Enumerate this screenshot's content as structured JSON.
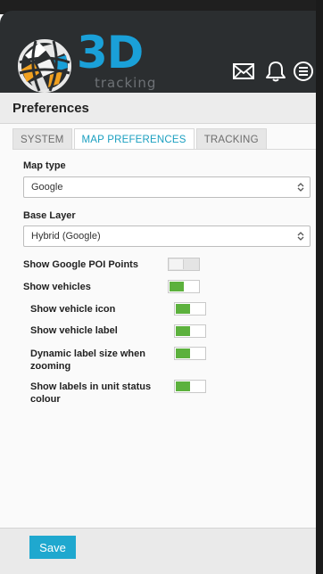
{
  "header": {
    "logo_text": "3D",
    "logo_sub": "tracking",
    "icons": [
      "mail-icon",
      "bell-icon",
      "menu-icon"
    ]
  },
  "page": {
    "title": "Preferences"
  },
  "tabs": [
    {
      "label": "SYSTEM",
      "active": false
    },
    {
      "label": "MAP PREFERENCES",
      "active": true
    },
    {
      "label": "TRACKING",
      "active": false
    }
  ],
  "map_type": {
    "label": "Map type",
    "value": "Google"
  },
  "base_layer": {
    "label": "Base Layer",
    "value": "Hybrid (Google)"
  },
  "toggles": {
    "google_poi": {
      "label": "Show Google POI Points",
      "on": false
    },
    "vehicles": {
      "label": "Show vehicles",
      "on": true
    },
    "vehicle_icon": {
      "label": "Show vehicle icon",
      "on": true
    },
    "vehicle_label": {
      "label": "Show vehicle label",
      "on": true
    },
    "dynamic_label": {
      "label": "Dynamic label size when zooming",
      "on": true
    },
    "status_colour": {
      "label": "Show labels in unit status colour",
      "on": true
    }
  },
  "footer": {
    "save_label": "Save"
  },
  "colors": {
    "accent": "#1fa8cf",
    "toggle_on": "#5cb13d",
    "header_bg": "#2b2e30",
    "logo_blue": "#1aa0d8",
    "logo_orange": "#f0a020"
  }
}
